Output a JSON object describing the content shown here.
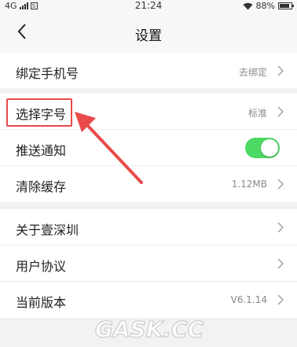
{
  "status_bar": {
    "network": "4G",
    "sim_label": "S",
    "time": "21:24",
    "battery": "88%",
    "battery_level": 0.88
  },
  "nav": {
    "title": "设置"
  },
  "group1": {
    "items": [
      {
        "label": "绑定手机号",
        "value": "去绑定"
      }
    ]
  },
  "group2": {
    "items": [
      {
        "label": "选择字号",
        "value": "标准"
      },
      {
        "label": "推送通知",
        "toggle": true
      },
      {
        "label": "清除缓存",
        "value": "1.12MB"
      }
    ]
  },
  "group3": {
    "items": [
      {
        "label": "关于壹深圳"
      },
      {
        "label": "用户协议"
      },
      {
        "label": "当前版本",
        "value": "V6.1.14"
      }
    ]
  },
  "watermark": {
    "text": "GASK.CC"
  },
  "colors": {
    "toggle_on": "#4cd964",
    "highlight": "#e94a4a"
  }
}
